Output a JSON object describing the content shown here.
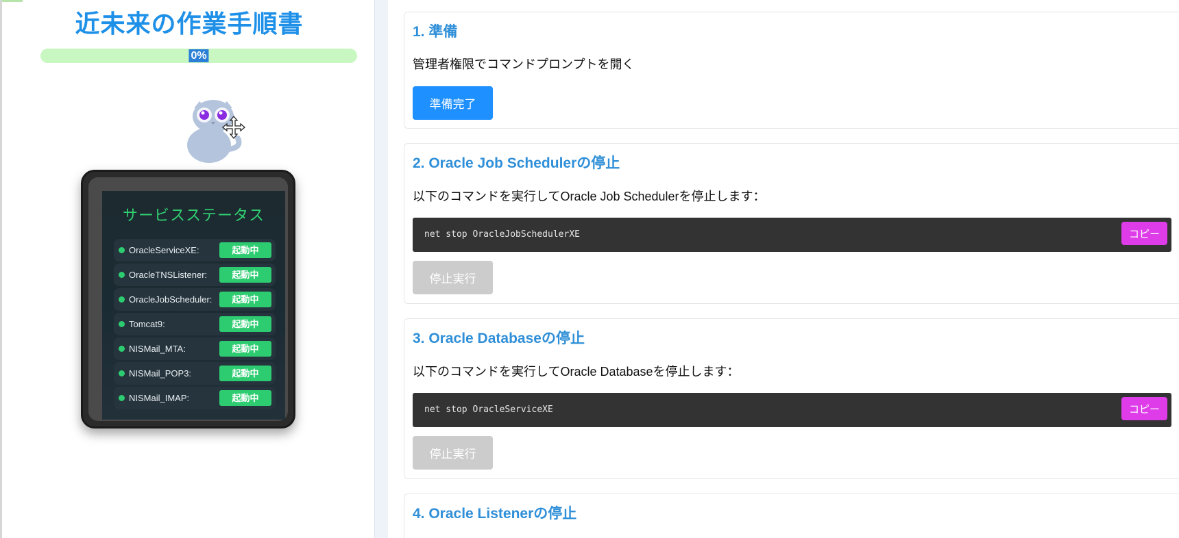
{
  "sidebar": {
    "title": "近未来の作業手順書",
    "progress": {
      "percent": 0,
      "label": "0%"
    },
    "status_panel": {
      "title": "サービスステータス",
      "services": [
        {
          "name": "OracleServiceXE:",
          "status": "起動中"
        },
        {
          "name": "OracleTNSListener:",
          "status": "起動中"
        },
        {
          "name": "OracleJobScheduler:",
          "status": "起動中"
        },
        {
          "name": "Tomcat9:",
          "status": "起動中"
        },
        {
          "name": "NISMail_MTA:",
          "status": "起動中"
        },
        {
          "name": "NISMail_POP3:",
          "status": "起動中"
        },
        {
          "name": "NISMail_IMAP:",
          "status": "起動中"
        }
      ]
    }
  },
  "steps": [
    {
      "title": "1. 準備",
      "description": "管理者権限でコマンドプロンプトを開く",
      "button": "準備完了"
    },
    {
      "title": "2. Oracle Job Schedulerの停止",
      "description": "以下のコマンドを実行してOracle Job Schedulerを停止します：",
      "command": "net stop OracleJobSchedulerXE",
      "copy_label": "コピー",
      "button": "停止実行"
    },
    {
      "title": "3. Oracle Databaseの停止",
      "description": "以下のコマンドを実行してOracle Databaseを停止します：",
      "command": "net stop OracleServiceXE",
      "copy_label": "コピー",
      "button": "停止実行"
    },
    {
      "title": "4. Oracle Listenerの停止"
    }
  ],
  "colors": {
    "accent": "#1e90ff",
    "heading": "#2f8fd8",
    "copy_button": "#dd3ce8",
    "status_running": "#2ecc71",
    "disabled": "#cccccc"
  },
  "icons": {
    "mascot": "owl-mascot-icon",
    "cursor": "move-cursor-icon",
    "status_dot": "status-dot-icon"
  }
}
